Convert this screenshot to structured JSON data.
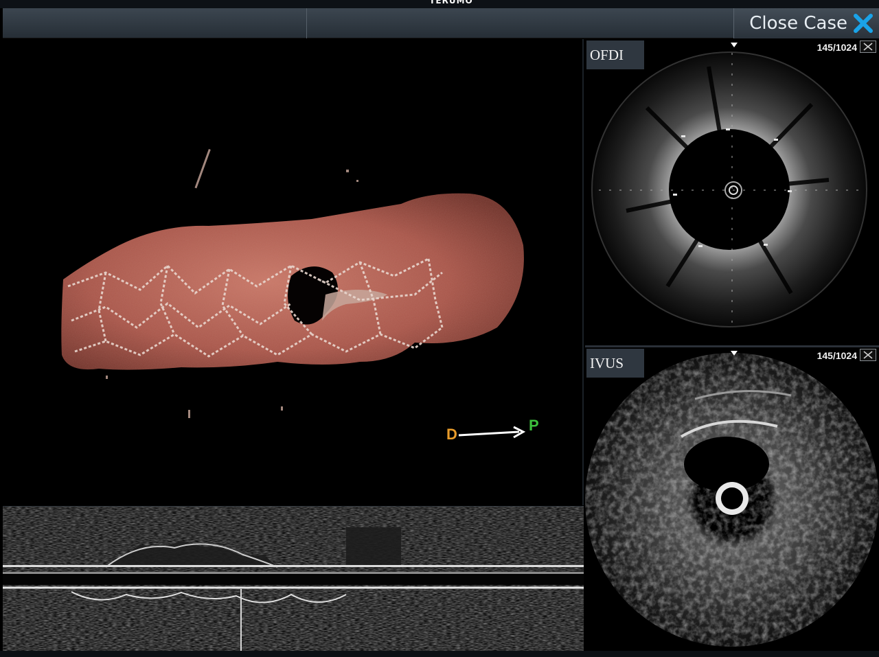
{
  "brand": "TERUMO",
  "header": {
    "close_case_label": "Close Case"
  },
  "orientation": {
    "distal_label": "D",
    "proximal_label": "P"
  },
  "panels": {
    "ofdi": {
      "label": "OFDI",
      "frame": "145/1024"
    },
    "ivus": {
      "label": "IVUS",
      "frame": "145/1024"
    }
  },
  "colors": {
    "accent_close": "#1aa3e8",
    "distal": "#e89b2a",
    "proximal": "#3cbf3c",
    "header_bg": "#2c343c"
  },
  "icons": {
    "close_case": "close-x-icon",
    "panel_close": "close-icon",
    "frame_marker": "triangle-marker-icon"
  }
}
